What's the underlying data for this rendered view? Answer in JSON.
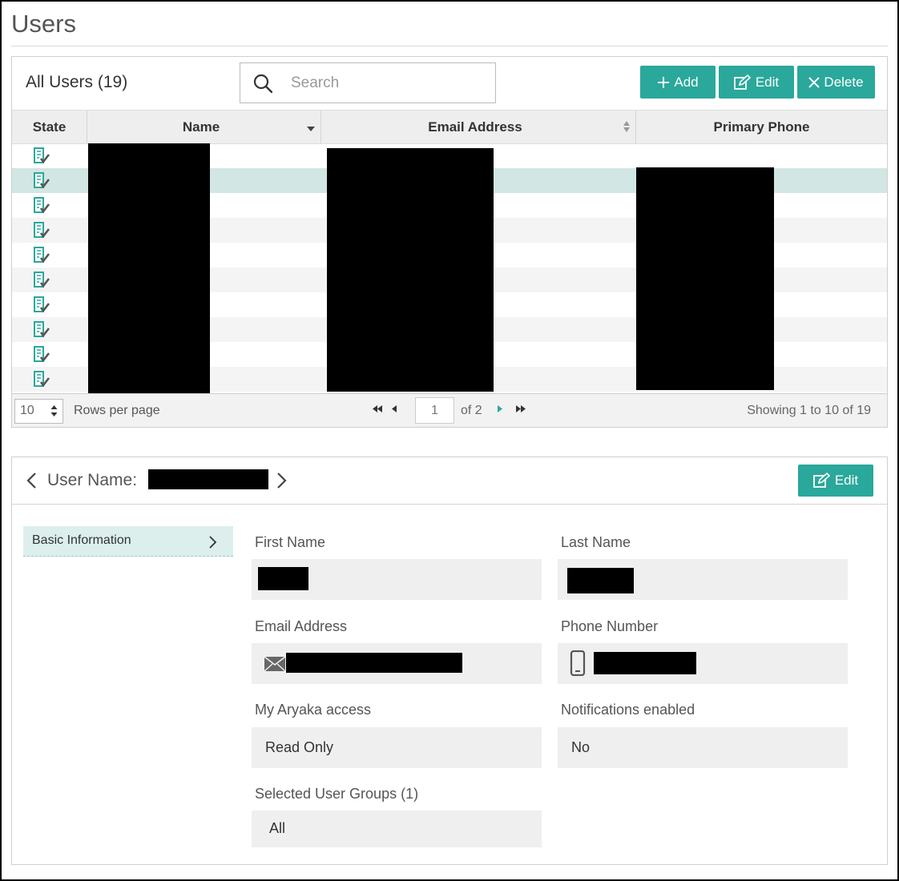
{
  "page": {
    "title": "Users"
  },
  "users_panel": {
    "title": "All Users (19)",
    "search_placeholder": "Search",
    "buttons": {
      "add": "Add",
      "edit": "Edit",
      "delete": "Delete"
    },
    "columns": [
      "State",
      "Name",
      "Email Address",
      "Primary Phone"
    ],
    "row_count_shown": 10,
    "selected_row_index": 1,
    "footer": {
      "rows_per_page_value": "10",
      "rows_per_page_label": "Rows per page",
      "current_page": "1",
      "page_of": "of 2",
      "showing": "Showing 1 to 10 of 19"
    }
  },
  "detail_panel": {
    "header_label": "User Name:",
    "edit_label": "Edit",
    "sidebar": [
      {
        "label": "Basic Information"
      }
    ],
    "fields": {
      "first_name_label": "First Name",
      "last_name_label": "Last Name",
      "email_label": "Email Address",
      "phone_label": "Phone Number",
      "aryaka_access_label": "My Aryaka access",
      "aryaka_access_value": "Read Only",
      "notifications_label": "Notifications enabled",
      "notifications_value": "No",
      "groups_label": "Selected User Groups (1)",
      "groups_value": "All"
    }
  },
  "colors": {
    "accent": "#2aa89b",
    "selected_row": "#d2e6e3",
    "redaction": "#000000"
  }
}
